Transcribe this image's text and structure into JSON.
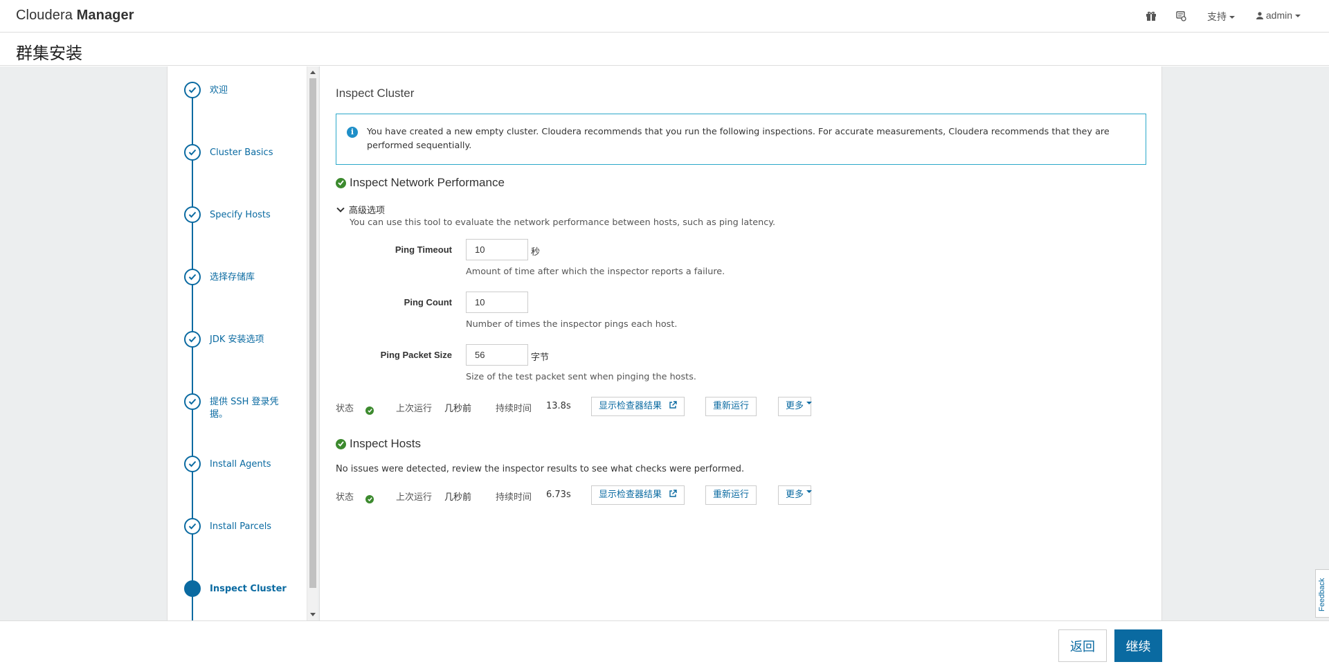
{
  "brand": {
    "light": "Cloudera",
    "bold": "Manager"
  },
  "topnav": {
    "support": "支持",
    "user": "admin"
  },
  "page_title": "群集安装",
  "steps": [
    {
      "label": "欢迎",
      "done": true
    },
    {
      "label": "Cluster Basics",
      "done": true
    },
    {
      "label": "Specify Hosts",
      "done": true
    },
    {
      "label": "选择存储库",
      "done": true
    },
    {
      "label": "JDK 安装选项",
      "done": true
    },
    {
      "label": "提供 SSH 登录凭据。",
      "done": true
    },
    {
      "label": "Install Agents",
      "done": true
    },
    {
      "label": "Install Parcels",
      "done": true
    },
    {
      "label": "Inspect Cluster",
      "done": false,
      "active": true
    }
  ],
  "section_title": "Inspect Cluster",
  "alert_text": "You have created a new empty cluster. Cloudera recommends that you run the following inspections. For accurate measurements, Cloudera recommends that they are performed sequentially.",
  "network": {
    "title": "Inspect Network Performance",
    "advanced_label": "高级选项",
    "description": "You can use this tool to evaluate the network performance between hosts, such as ping latency.",
    "fields": [
      {
        "label": "Ping Timeout",
        "value": "10",
        "unit": "秒",
        "help": "Amount of time after which the inspector reports a failure."
      },
      {
        "label": "Ping Count",
        "value": "10",
        "unit": "",
        "help": "Number of times the inspector pings each host."
      },
      {
        "label": "Ping Packet Size",
        "value": "56",
        "unit": "字节",
        "help": "Size of the test packet sent when pinging the hosts."
      }
    ],
    "status": {
      "status_label": "状态",
      "last_run_label": "上次运行",
      "last_run": "几秒前",
      "duration_label": "持续时间",
      "duration": "13.8s",
      "show_results": "显示检查器结果",
      "rerun": "重新运行",
      "more": "更多"
    }
  },
  "hosts": {
    "title": "Inspect Hosts",
    "message": "No issues were detected, review the inspector results to see what checks were performed.",
    "status": {
      "status_label": "状态",
      "last_run_label": "上次运行",
      "last_run": "几秒前",
      "duration_label": "持续时间",
      "duration": "6.73s",
      "show_results": "显示检查器结果",
      "rerun": "重新运行",
      "more": "更多"
    }
  },
  "footer": {
    "back": "返回",
    "next": "继续"
  },
  "feedback": "Feedback",
  "colors": {
    "accent": "#0a6aa1",
    "success": "#3c8a2e",
    "info_border": "#2aa7c9"
  }
}
